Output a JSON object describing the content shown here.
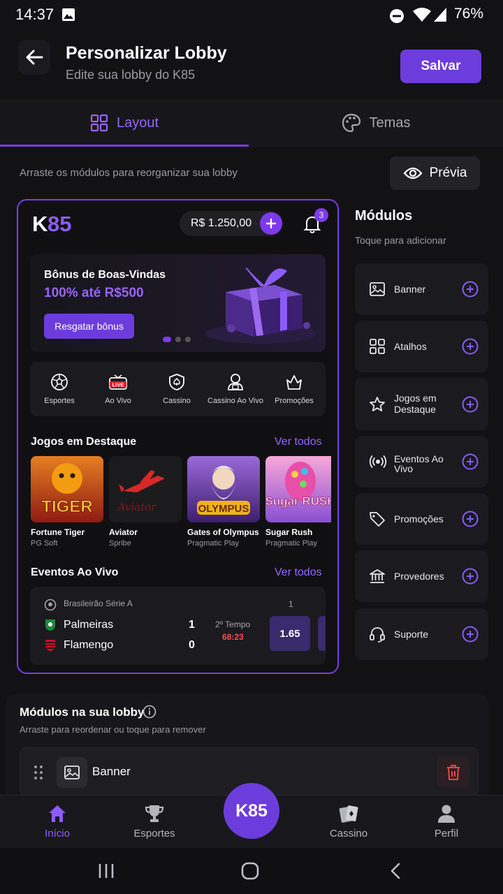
{
  "status_bar": {
    "time": "14:37",
    "battery": "76%"
  },
  "header": {
    "title": "Personalizar Lobby",
    "subtitle": "Edite sua lobby do K85",
    "save_label": "Salvar"
  },
  "tabs": [
    {
      "label": "Layout",
      "active": true
    },
    {
      "label": "Temas",
      "active": false
    }
  ],
  "hint": "Arraste os módulos para reorganizar sua lobby",
  "preview_label": "Prévia",
  "preview": {
    "logo": "K85",
    "balance": "R$ 1.250,00",
    "notifications": "3",
    "banner": {
      "title": "Bônus de Boas-Vindas",
      "subtitle": "100% até R$500",
      "button": "Resgatar bônus"
    },
    "shortcuts": [
      "Esportes",
      "Ao Vivo",
      "Cassino",
      "Cassino Ao Vivo",
      "Promoções"
    ],
    "live_badge": "LIVE",
    "featured": {
      "title": "Jogos em Destaque",
      "see_all": "Ver todos",
      "games": [
        {
          "name": "Fortune Tiger",
          "provider": "PG Soft",
          "art_text": "TIGER"
        },
        {
          "name": "Aviator",
          "provider": "Spribe",
          "art_text": "Aviator"
        },
        {
          "name": "Gates of Olympus",
          "provider": "Pragmatic Play",
          "art_text": "OLYMPUS"
        },
        {
          "name": "Sugar Rush",
          "provider": "Pragmatic Play",
          "art_text": "Sugar RUSH"
        }
      ]
    },
    "live_events": {
      "title": "Eventos Ao Vivo",
      "see_all": "Ver todos",
      "event": {
        "league": "Brasileirão Série A",
        "home": "Palmeiras",
        "home_score": "1",
        "away": "Flamengo",
        "away_score": "0",
        "period": "2º Tempo",
        "clock": "68:23",
        "odd_header": "1",
        "odd": "1.65"
      }
    }
  },
  "modules": {
    "title": "Módulos",
    "subtitle": "Toque para adicionar",
    "items": [
      {
        "label": "Banner",
        "icon": "image-icon"
      },
      {
        "label": "Atalhos",
        "icon": "grid-icon"
      },
      {
        "label": "Jogos em Destaque",
        "icon": "star-icon"
      },
      {
        "label": "Eventos Ao Vivo",
        "icon": "broadcast-icon"
      },
      {
        "label": "Promoções",
        "icon": "tag-icon"
      },
      {
        "label": "Provedores",
        "icon": "bank-icon"
      },
      {
        "label": "Suporte",
        "icon": "headset-icon"
      }
    ]
  },
  "lobby": {
    "title": "Módulos na sua lobby",
    "subtitle": "Arraste para reordenar ou toque para remover",
    "items": [
      {
        "label": "Banner"
      }
    ]
  },
  "bottom_nav": [
    {
      "label": "Início",
      "active": true
    },
    {
      "label": "Esportes"
    },
    {
      "label": "Cassino"
    },
    {
      "label": "Perfil"
    }
  ],
  "fab_label": "K85",
  "colors": {
    "accent": "#7c3aed",
    "background": "#121214",
    "card": "#1a1a1f",
    "live_red": "#ff4d4d"
  }
}
